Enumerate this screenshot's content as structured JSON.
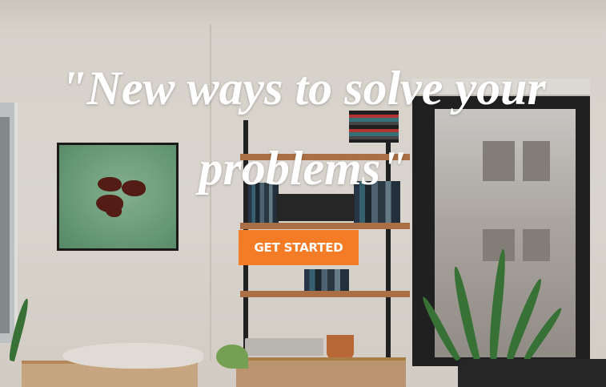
{
  "hero": {
    "headline": "\"New ways to solve your problems\"",
    "background_image": "living-room-with-shelf-painting-plants"
  },
  "cta": {
    "label": "GET STARTED",
    "color": "#f47c26",
    "text_color": "#ffffff"
  },
  "colors": {
    "headline_text": "#ffffff",
    "wall": "#e9e4dc"
  }
}
